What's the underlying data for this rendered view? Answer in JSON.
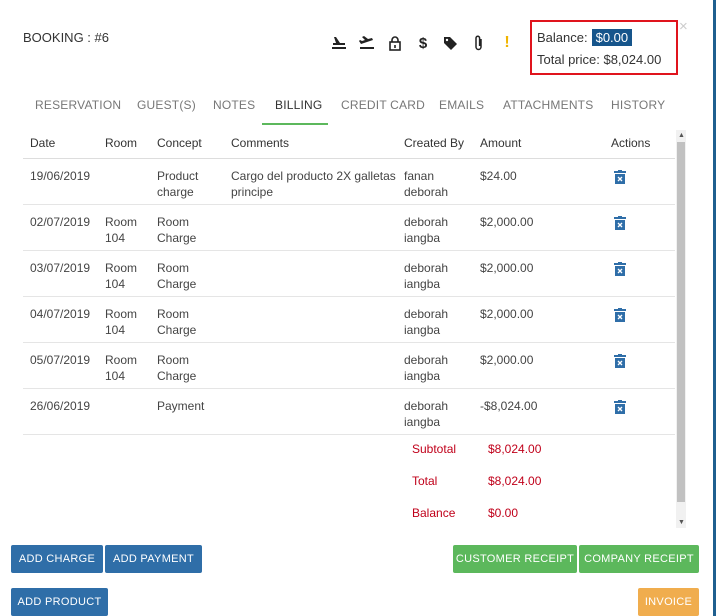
{
  "header": {
    "title": "BOOKING : #6",
    "balance_label": "Balance:",
    "balance_value": "$0.00",
    "total_label": "Total price: $8,024.00",
    "close_icon": "×"
  },
  "toolbar_icons": [
    "arrival-icon",
    "departure-icon",
    "lock-icon",
    "dollar-icon",
    "tag-icon",
    "paperclip-icon",
    "warning-icon"
  ],
  "warning_text": "!",
  "dollar_text": "$",
  "tabs": [
    {
      "label": "RESERVATION"
    },
    {
      "label": "GUEST(S)"
    },
    {
      "label": "NOTES"
    },
    {
      "label": "BILLING"
    },
    {
      "label": "CREDIT CARD"
    },
    {
      "label": "EMAILS"
    },
    {
      "label": "ATTACHMENTS"
    },
    {
      "label": "HISTORY"
    }
  ],
  "columns": [
    "Date",
    "Room",
    "Concept",
    "Comments",
    "Created By",
    "Amount",
    "Actions"
  ],
  "rows": [
    {
      "date": "19/06/2019",
      "room": "",
      "concept": "Product charge",
      "comments": "Cargo del producto 2X galletas principe",
      "created_by": "fanan deborah",
      "amount": "$24.00"
    },
    {
      "date": "02/07/2019",
      "room": "Room 104",
      "concept": "Room Charge",
      "comments": "",
      "created_by": "deborah iangba",
      "amount": "$2,000.00"
    },
    {
      "date": "03/07/2019",
      "room": "Room 104",
      "concept": "Room Charge",
      "comments": "",
      "created_by": "deborah iangba",
      "amount": "$2,000.00"
    },
    {
      "date": "04/07/2019",
      "room": "Room 104",
      "concept": "Room Charge",
      "comments": "",
      "created_by": "deborah iangba",
      "amount": "$2,000.00"
    },
    {
      "date": "05/07/2019",
      "room": "Room 104",
      "concept": "Room Charge",
      "comments": "",
      "created_by": "deborah iangba",
      "amount": "$2,000.00"
    },
    {
      "date": "26/06/2019",
      "room": "",
      "concept": "Payment",
      "comments": "",
      "created_by": "deborah iangba",
      "amount": "-$8,024.00"
    }
  ],
  "summary": {
    "subtotal_label": "Subtotal",
    "subtotal_value": "$8,024.00",
    "total_label": "Total",
    "total_value": "$8,024.00",
    "balance_label": "Balance",
    "balance_value": "$0.00"
  },
  "buttons": {
    "add_charge": "ADD CHARGE",
    "add_payment": "ADD PAYMENT",
    "customer_receipt": "CUSTOMER RECEIPT",
    "company_receipt": "COMPANY RECEIPT",
    "add_product": "ADD PRODUCT",
    "invoice": "INVOICE"
  },
  "colors": {
    "primary": "#2f6ea8",
    "success": "#5cb85c",
    "warning": "#f0ad4e",
    "danger": "#c0001a",
    "highlight_border": "#e0141d"
  }
}
